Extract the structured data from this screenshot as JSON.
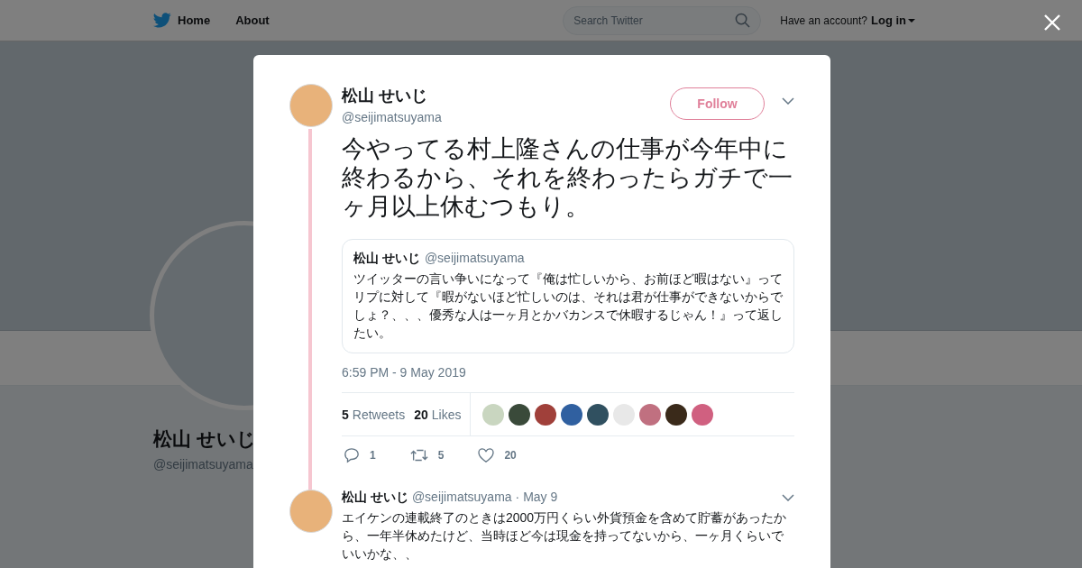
{
  "nav": {
    "items": [
      {
        "label": "Home",
        "kind": "home"
      },
      {
        "label": "About",
        "kind": "plain"
      }
    ],
    "search": {
      "placeholder": "Search Twitter"
    },
    "account_prompt": "Have an account?",
    "login": "Log in"
  },
  "profile": {
    "name": "松山 せいじ",
    "handle": "@seijimatsuyama"
  },
  "tweet": {
    "name": "松山 せいじ",
    "handle": "@seijimatsuyama",
    "follow": "Follow",
    "text": "今やってる村上隆さんの仕事が今年中に終わるから、それを終わったらガチで一ヶ月以上休むつもり。",
    "quote": {
      "name": "松山 せいじ",
      "handle": "@seijimatsuyama",
      "text": "ツイッターの言い争いになって『俺は忙しいから、お前ほど暇はない』ってリプに対して『暇がないほど忙しいのは、それは君が仕事ができないからでしょ？、、、優秀な人は一ヶ月とかバカンスで休暇するじゃん！』って返したい。"
    },
    "time": "6:59 PM - 9 May 2019",
    "retweets": "5",
    "retweets_label": "Retweets",
    "likes": "20",
    "likes_label": "Likes",
    "likers": [
      {
        "color": "#c9d6c0"
      },
      {
        "color": "#3a4a3a"
      },
      {
        "color": "#a0403a"
      },
      {
        "color": "#3060a0"
      },
      {
        "color": "#305060"
      },
      {
        "color": "#e8e8e8"
      },
      {
        "color": "#c07080"
      },
      {
        "color": "#3a2a1a"
      },
      {
        "color": "#d06080"
      }
    ],
    "actions": [
      {
        "kind": "reply",
        "count": "1"
      },
      {
        "kind": "retweet",
        "count": "5"
      },
      {
        "kind": "like",
        "count": "20"
      }
    ]
  },
  "reply": {
    "name": "松山 せいじ",
    "handle": "@seijimatsuyama",
    "date": "· May 9",
    "text": "エイケンの連載終了のときは2000万円くらい外貨預金を含めて貯蓄があったから、一年半休めたけど、当時ほど今は現金を持ってないから、一ヶ月くらいでいいかな、、"
  }
}
